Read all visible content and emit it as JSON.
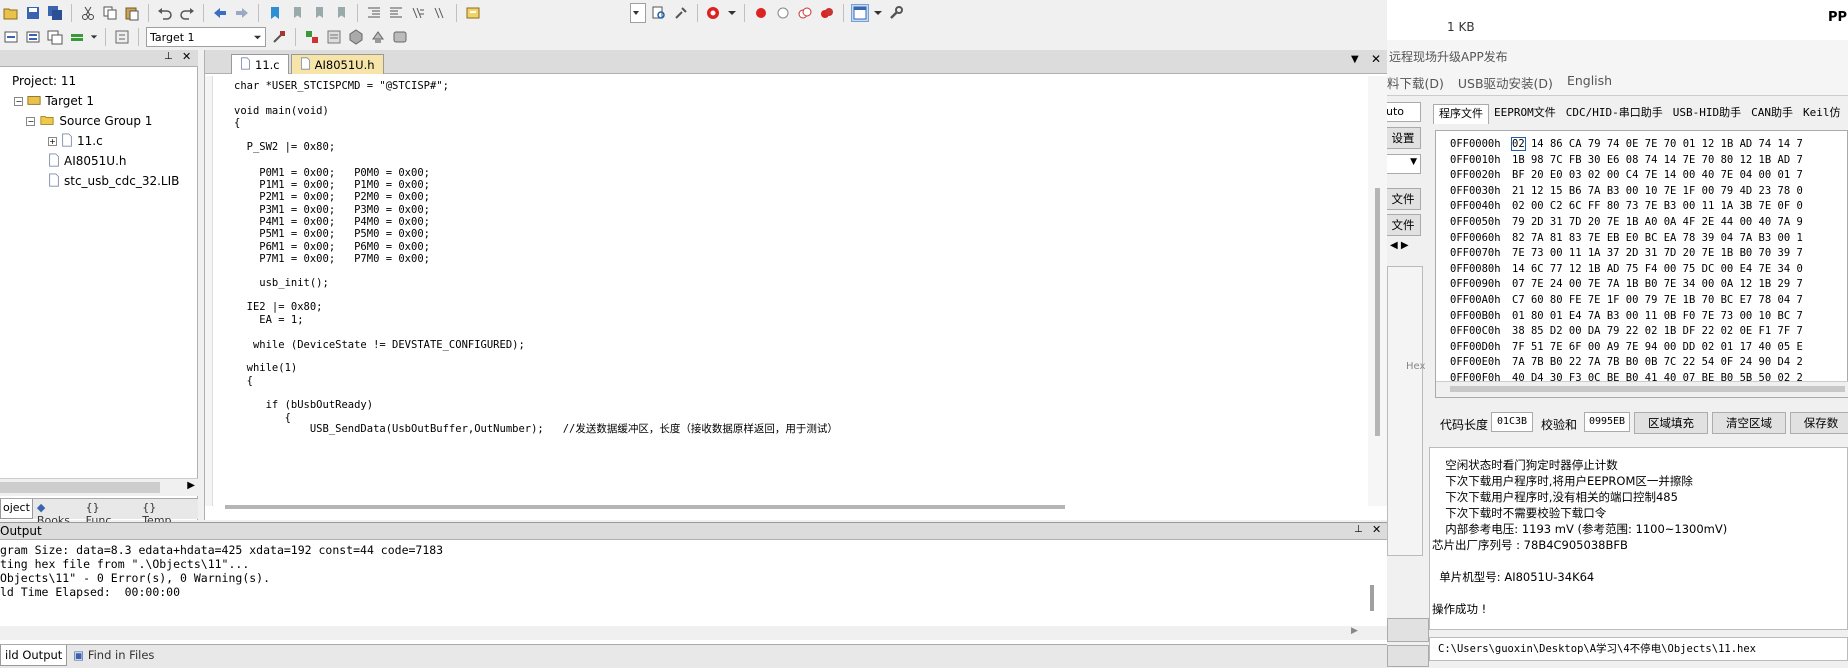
{
  "ide": {
    "target_select": "Target 1",
    "tabs": [
      {
        "label": "11.c",
        "active": true
      },
      {
        "label": "AI8051U.h",
        "active": false
      }
    ],
    "project_tree": [
      {
        "label": "Project: 11",
        "level": 0,
        "kind": "project"
      },
      {
        "label": "Target 1",
        "level": 1,
        "kind": "target"
      },
      {
        "label": "Source Group 1",
        "level": 2,
        "kind": "folder"
      },
      {
        "label": "11.c",
        "level": 3,
        "kind": "file"
      },
      {
        "label": "AI8051U.h",
        "level": 3,
        "kind": "file"
      },
      {
        "label": "stc_usb_cdc_32.LIB",
        "level": 3,
        "kind": "file"
      }
    ],
    "panel_tabs": [
      "oject",
      "Books",
      "Func...",
      "Temp..."
    ],
    "code_lines": [
      "char *USER_STCISPCMD = \"@STCISP#\";",
      "",
      "void main(void)",
      "{",
      "",
      "  P_SW2 |= 0x80;",
      "",
      "    P0M1 = 0x00;   P0M0 = 0x00;",
      "    P1M1 = 0x00;   P1M0 = 0x00;",
      "    P2M1 = 0x00;   P2M0 = 0x00;",
      "    P3M1 = 0x00;   P3M0 = 0x00;",
      "    P4M1 = 0x00;   P4M0 = 0x00;",
      "    P5M1 = 0x00;   P5M0 = 0x00;",
      "    P6M1 = 0x00;   P6M0 = 0x00;",
      "    P7M1 = 0x00;   P7M0 = 0x00;",
      "",
      "    usb_init();",
      "",
      "  IE2 |= 0x80;",
      "    EA = 1;",
      "",
      "   while (DeviceState != DEVSTATE_CONFIGURED);",
      "",
      "  while(1)",
      "  {",
      "",
      "     if (bUsbOutReady)",
      "        {",
      "            USB_SendData(UsbOutBuffer,OutNumber);   //发送数据缓冲区，长度（接收数据原样返回，用于测试）"
    ],
    "output": {
      "title": "Output",
      "lines": [
        "gram Size: data=8.3 edata+hdata=425 xdata=192 const=44 code=7183",
        "ting hex file from \".\\Objects\\11\"...",
        "Objects\\11\" - 0 Error(s), 0 Warning(s).",
        "ld Time Elapsed:  00:00:00"
      ],
      "tabs": [
        "ild Output",
        "Find in Files"
      ]
    }
  },
  "isp": {
    "size_text": "1 KB",
    "top_right_text": "PP",
    "menu_title": "远程现场升级APP发布",
    "menu_links": [
      "料下载(D)",
      "USB驱动安装(D)",
      "English"
    ],
    "left_partial": [
      "uto",
      "设置",
      "文件",
      "文件",
      "Hex"
    ],
    "tabs": [
      "程序文件",
      "EEPROM文件",
      "CDC/HID-串口助手",
      "USB-HID助手",
      "CAN助手",
      "Keil仿"
    ],
    "hex_rows": [
      {
        "addr": "0FF0000h",
        "bytes": "02 14 86 CA 79 74 0E 7E 70 01 12 1B AD 74 14 7"
      },
      {
        "addr": "0FF0010h",
        "bytes": "1B 98 7C FB 30 E6 08 74 14 7E 70 80 12 1B AD 7"
      },
      {
        "addr": "0FF0020h",
        "bytes": "BF 20 E0 03 02 00 C4 7E 14 00 40 7E 04 00 01 7"
      },
      {
        "addr": "0FF0030h",
        "bytes": "21 12 15 B6 7A B3 00 10 7E 1F 00 79 4D 23 78 0"
      },
      {
        "addr": "0FF0040h",
        "bytes": "02 00 C2 6C FF 80 73 7E B3 00 11 1A 3B 7E 0F 0"
      },
      {
        "addr": "0FF0050h",
        "bytes": "79 2D 31 7D 20 7E 1B A0 0A 4F 2E 44 00 40 7A 9"
      },
      {
        "addr": "0FF0060h",
        "bytes": "82 7A 81 83 7E EB E0 BC EA 78 39 04 7A B3 00 1"
      },
      {
        "addr": "0FF0070h",
        "bytes": "7E 73 00 11 1A 37 2D 31 7D 20 7E 1B B0 70 39 7"
      },
      {
        "addr": "0FF0080h",
        "bytes": "14 6C 77 12 1B AD 75 F4 00 75 DC 00 E4 7E 34 0"
      },
      {
        "addr": "0FF0090h",
        "bytes": "07 7E 24 00 7E 7A 1B B0 7E 34 00 0A 12 1B 29 7"
      },
      {
        "addr": "0FF00A0h",
        "bytes": "C7 60 80 FE 7E 1F 00 79 7E 1B 70 BC E7 78 04 7"
      },
      {
        "addr": "0FF00B0h",
        "bytes": "01 80 01 E4 7A B3 00 11 0B F0 7E 73 00 10 BC 7"
      },
      {
        "addr": "0FF00C0h",
        "bytes": "38 85 D2 00 DA 79 22 02 1B DF 22 02 0E F1 7F 7"
      },
      {
        "addr": "0FF00D0h",
        "bytes": "7F 51 7E 6F 00 A9 7E 94 00 DD 02 01 17 40 05 E"
      },
      {
        "addr": "0FF00E0h",
        "bytes": "7A 7B B0 22 7A 7B B0 0B 7C 22 54 0F 24 90 D4 2"
      },
      {
        "addr": "0FF00F0h",
        "bytes": "40 D4 30 F3 0C BE B0 41 40 07 BE B0 5B 50 02 2"
      }
    ],
    "code_length_label": "代码长度",
    "code_length_value": "01C3B",
    "checksum_label": "校验和",
    "checksum_value": "0995EB",
    "fill_button": "区域填充",
    "clear_button": "清空区域",
    "save_button": "保存数",
    "log_lines": [
      "  空闲状态时看门狗定时器停止计数",
      "  下次下载用户程序时,将用户EEPROM区一并擦除",
      "  下次下载用户程序时,没有相关的端口控制485",
      "  下次下载时不需要校验下载口令",
      "  内部参考电压: 1193 mV (参考范围: 1100~1300mV)",
      "芯片出厂序列号 : 78B4C905038BFB",
      "",
      "  单片机型号: AI8051U-34K64",
      "",
      "操作成功 !"
    ],
    "status_path": "C:\\Users\\guoxin\\Desktop\\A学习\\4不停电\\Objects\\11.hex"
  }
}
